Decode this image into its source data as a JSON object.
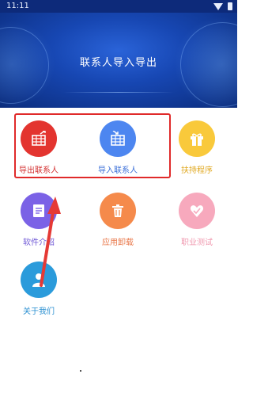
{
  "status_bar": {
    "time": "11:11"
  },
  "header": {
    "title": "联系人导入导出"
  },
  "grid": [
    {
      "label": "导出联系人",
      "icon": "export-table-icon",
      "color": "#e3342f",
      "label_color": "#d32f2f"
    },
    {
      "label": "导入联系人",
      "icon": "import-table-icon",
      "color": "#4d86f0",
      "label_color": "#3b6fd8"
    },
    {
      "label": "扶持程序",
      "icon": "gift-box-icon",
      "color": "#f9c93b",
      "label_color": "#e0a820"
    },
    {
      "label": "软件介绍",
      "icon": "document-icon",
      "color": "#7b62e6",
      "label_color": "#6e57d6"
    },
    {
      "label": "应用卸载",
      "icon": "trash-icon",
      "color": "#f58a4b",
      "label_color": "#e9784a"
    },
    {
      "label": "职业测试",
      "icon": "heart-check-icon",
      "color": "#f7a9bd",
      "label_color": "#f09ab0"
    },
    {
      "label": "关于我们",
      "icon": "user-icon",
      "color": "#2b9bdb",
      "label_color": "#2a8fd1"
    }
  ]
}
